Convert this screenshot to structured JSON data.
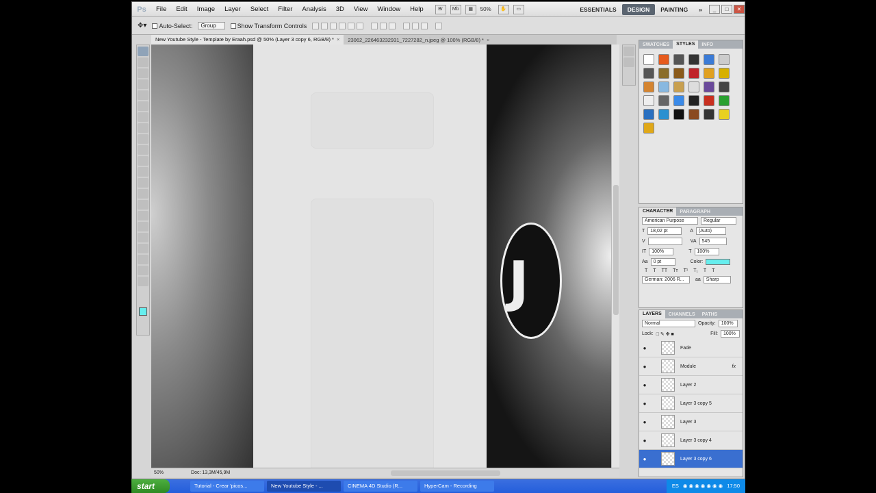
{
  "menubar": {
    "logo": "Ps",
    "items": [
      "File",
      "Edit",
      "Image",
      "Layer",
      "Select",
      "Filter",
      "Analysis",
      "3D",
      "View",
      "Window",
      "Help"
    ],
    "zoom": "50%",
    "workspaces": [
      "ESSENTIALS",
      "DESIGN",
      "PAINTING"
    ],
    "more": "»"
  },
  "options": {
    "auto_select": "Auto-Select:",
    "auto_select_value": "Group",
    "show_transform": "Show Transform Controls"
  },
  "doc_tabs": [
    {
      "label": "New Youtube Style - Template by Eraah.psd @ 50% (Layer 3 copy 6, RGB/8) *"
    },
    {
      "label": "23062_226463232931_7227282_n.jpeg @ 100% (RGB/8) *"
    }
  ],
  "status": {
    "zoom": "50%",
    "doc": "Doc: 13,3M/45,9M"
  },
  "panels": {
    "swatches_tabs": [
      "SWATCHES",
      "STYLES",
      "INFO"
    ],
    "styles_colors": [
      "#ffffff",
      "#e65a1c",
      "#555555",
      "#333333",
      "#3b7bd6",
      "#cccccc",
      "#555555",
      "#8a6d2a",
      "#8a5a1a",
      "#c0242a",
      "#e0a020",
      "#d7b000",
      "#d48430",
      "#88b8e0",
      "#c8a050",
      "#dddddd",
      "#6a4a9a",
      "#444444",
      "#eeeeee",
      "#666666",
      "#3a8ae8",
      "#222222",
      "#c83020",
      "#2aa030",
      "#2a70c0",
      "#2a90d0",
      "#111111",
      "#8a4a20",
      "#333333",
      "#e8d020",
      "#e0a818"
    ],
    "character_tabs": [
      "CHARACTER",
      "PARAGRAPH"
    ],
    "font_family": "American Purpose",
    "font_style": "Regular",
    "font_size": "18,02 pt",
    "leading": "(Auto)",
    "tracking": "545",
    "vscale": "100%",
    "hscale": "100%",
    "baseline": "0 pt",
    "color_label": "Color:",
    "language": "German: 2006 R...",
    "aa_label": "aa",
    "antialias": "Sharp",
    "layers_tabs": [
      "LAYERS",
      "CHANNELS",
      "PATHS"
    ],
    "blend_mode": "Normal",
    "opacity_label": "Opacity:",
    "opacity": "100%",
    "lock_label": "Lock:",
    "fill_label": "Fill:",
    "fill": "100%",
    "layers": [
      {
        "name": "Fade",
        "fx": ""
      },
      {
        "name": "Module",
        "fx": "fx"
      },
      {
        "name": "Layer 2",
        "fx": ""
      },
      {
        "name": "Layer 3 copy 5",
        "fx": ""
      },
      {
        "name": "Layer 3",
        "fx": ""
      },
      {
        "name": "Layer 3 copy 4",
        "fx": ""
      },
      {
        "name": "Layer 3 copy 6",
        "fx": ""
      }
    ]
  },
  "taskbar": {
    "start": "start",
    "buttons": [
      "Tutorial - Crear 'picos...",
      "New Youtube Style - ...",
      "CINEMA 4D Studio (R...",
      "HyperCam - Recording"
    ],
    "lang": "ES",
    "time": "17:50"
  }
}
